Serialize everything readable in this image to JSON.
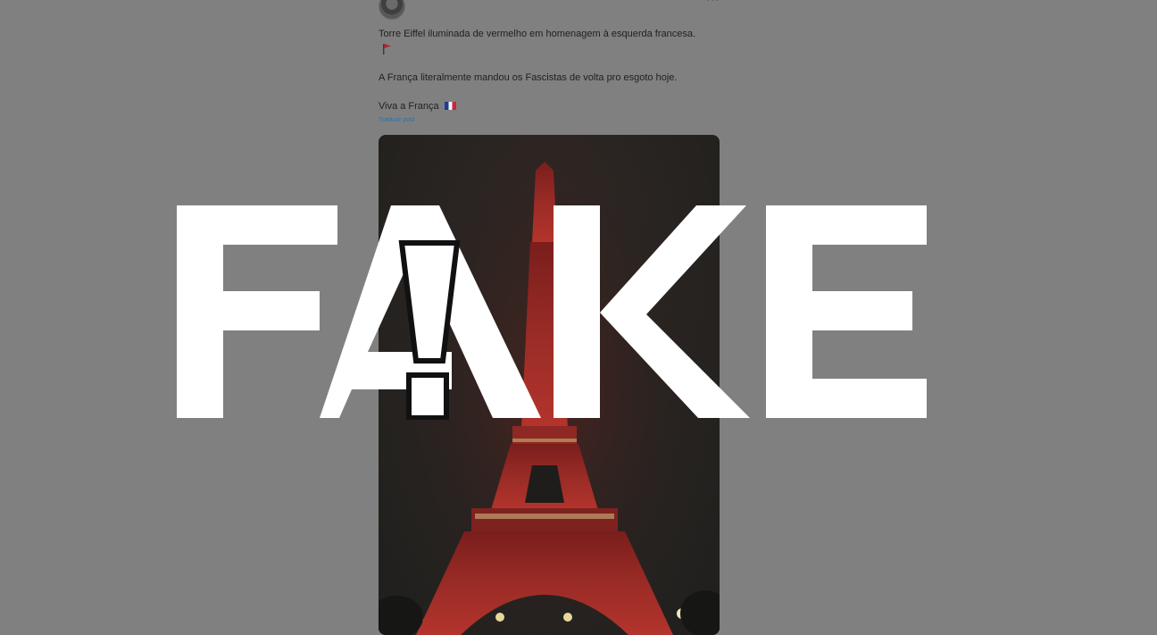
{
  "post": {
    "line1": "Torre Eiffel iluminada de vermelho em homenagem à esquerda francesa.",
    "line2": "A França literalmente mandou os Fascistas de volta pro esgoto hoje.",
    "line3": "Viva a França",
    "translate_label": "Traduzir post",
    "more_label": "···",
    "flag_emoji_1": "red-triangular-flag-icon",
    "flag_emoji_2": "france-flag-icon"
  },
  "stamp": {
    "label": "FAKE",
    "color": "#ffffff"
  },
  "photo": {
    "subject": "eiffel-tower-red-lights"
  },
  "colors": {
    "overlay": "#808080",
    "tower_red": "#b3342c",
    "link": "#2f6fa8"
  }
}
